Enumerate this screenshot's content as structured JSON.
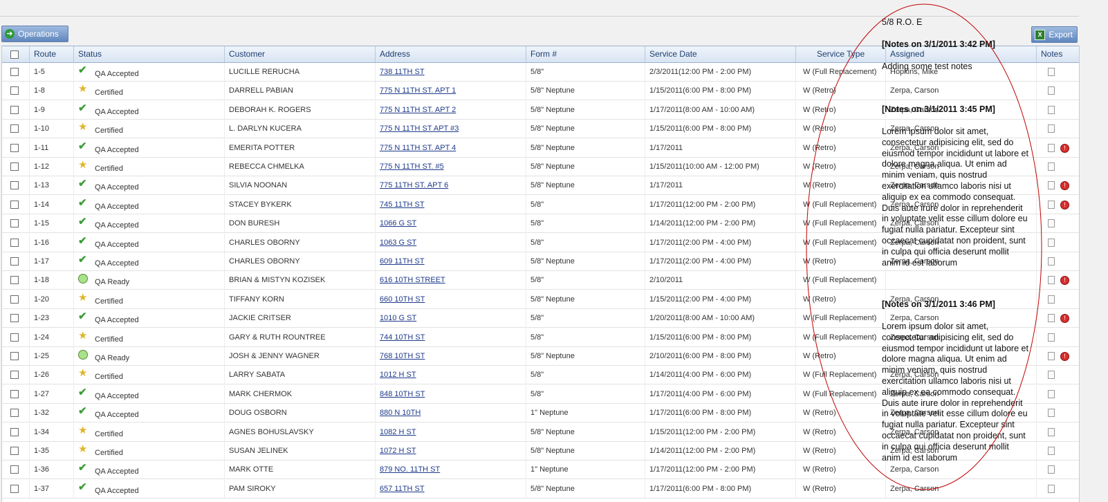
{
  "toolbar": {
    "operations_label": "Operations",
    "export_label": "Export",
    "export_icon": "excel-icon",
    "operations_icon": "arrow-right-icon"
  },
  "colors": {
    "header_text": "#1f3d6e",
    "link": "#1e3a8a",
    "annotation_ellipse": "#c00000",
    "note_flag": "#d92d2d",
    "check": "#3f9c3a",
    "star": "#e0b526"
  },
  "grid": {
    "columns": [
      "Route",
      "Status",
      "Customer",
      "Address",
      "Form #",
      "Service Date",
      "Service Type",
      "Assigned",
      "Notes"
    ],
    "rows": [
      {
        "route": "1-5",
        "status": "QA Accepted",
        "status_icon": "check",
        "customer": "LUCILLE RERUCHA",
        "address": "738 11TH ST",
        "form": "5/8\"",
        "date": "2/3/2011(12:00 PM - 2:00 PM)",
        "type": "W (Full Replacement)",
        "assigned": "Hopkins, Mike",
        "flag": false
      },
      {
        "route": "1-8",
        "status": "Certified",
        "status_icon": "star",
        "customer": "DARRELL PABIAN",
        "address": "775 N 11TH ST. APT 1",
        "form": "5/8\" Neptune",
        "date": "1/15/2011(6:00 PM - 8:00 PM)",
        "type": "W (Retro)",
        "assigned": "Zerpa, Carson",
        "flag": false
      },
      {
        "route": "1-9",
        "status": "QA Accepted",
        "status_icon": "check",
        "customer": "DEBORAH K. ROGERS",
        "address": "775 N 11TH ST. APT 2",
        "form": "5/8\" Neptune",
        "date": "1/17/2011(8:00 AM - 10:00 AM)",
        "type": "W (Retro)",
        "assigned": "Zerpa, Carson",
        "flag": false
      },
      {
        "route": "1-10",
        "status": "Certified",
        "status_icon": "star",
        "customer": "L. DARLYN KUCERA",
        "address": "775 N 11TH ST APT #3",
        "form": "5/8\" Neptune",
        "date": "1/15/2011(6:00 PM - 8:00 PM)",
        "type": "W (Retro)",
        "assigned": "Zerpa, Carson",
        "flag": false
      },
      {
        "route": "1-11",
        "status": "QA Accepted",
        "status_icon": "check",
        "customer": "EMERITA POTTER",
        "address": "775 N 11TH ST. APT 4",
        "form": "5/8\" Neptune",
        "date": "1/17/2011",
        "type": "W (Retro)",
        "assigned": "Zerpa, Carson",
        "flag": true
      },
      {
        "route": "1-12",
        "status": "Certified",
        "status_icon": "star",
        "customer": "REBECCA CHMELKA",
        "address": "775 N 11TH ST. #5",
        "form": "5/8\" Neptune",
        "date": "1/15/2011(10:00 AM - 12:00 PM)",
        "type": "W (Retro)",
        "assigned": "Zerpa, Carson",
        "flag": false
      },
      {
        "route": "1-13",
        "status": "QA Accepted",
        "status_icon": "check",
        "customer": "SILVIA NOONAN",
        "address": "775 11TH ST. APT 6",
        "form": "5/8\" Neptune",
        "date": "1/17/2011",
        "type": "W (Retro)",
        "assigned": "Zerpa, Carson",
        "flag": true
      },
      {
        "route": "1-14",
        "status": "QA Accepted",
        "status_icon": "check",
        "customer": "STACEY BYKERK",
        "address": "745 11TH ST",
        "form": "5/8\"",
        "date": "1/17/2011(12:00 PM - 2:00 PM)",
        "type": "W (Full Replacement)",
        "assigned": "Zerpa, Carson",
        "flag": true
      },
      {
        "route": "1-15",
        "status": "QA Accepted",
        "status_icon": "check",
        "customer": "DON BURESH",
        "address": "1066 G ST",
        "form": "5/8\"",
        "date": "1/14/2011(12:00 PM - 2:00 PM)",
        "type": "W (Full Replacement)",
        "assigned": "Zerpa, Carson",
        "flag": false
      },
      {
        "route": "1-16",
        "status": "QA Accepted",
        "status_icon": "check",
        "customer": "CHARLES OBORNY",
        "address": "1063 G ST",
        "form": "5/8\"",
        "date": "1/17/2011(2:00 PM - 4:00 PM)",
        "type": "W (Full Replacement)",
        "assigned": "Zerpa, Carson",
        "flag": false
      },
      {
        "route": "1-17",
        "status": "QA Accepted",
        "status_icon": "check",
        "customer": "CHARLES OBORNY",
        "address": "609 11TH ST",
        "form": "5/8\" Neptune",
        "date": "1/17/2011(2:00 PM - 4:00 PM)",
        "type": "W (Retro)",
        "assigned": "Zerpa, Carson",
        "flag": false
      },
      {
        "route": "1-18",
        "status": "QA Ready",
        "status_icon": "ready",
        "customer": "BRIAN & MISTYN KOZISEK",
        "address": "616 10TH STREET",
        "form": "5/8\"",
        "date": "2/10/2011",
        "type": "W (Full Replacement)",
        "assigned": "",
        "flag": true
      },
      {
        "route": "1-20",
        "status": "Certified",
        "status_icon": "star",
        "customer": "TIFFANY KORN",
        "address": "660 10TH ST",
        "form": "5/8\" Neptune",
        "date": "1/15/2011(2:00 PM - 4:00 PM)",
        "type": "W (Retro)",
        "assigned": "Zerpa, Carson",
        "flag": false
      },
      {
        "route": "1-23",
        "status": "QA Accepted",
        "status_icon": "check",
        "customer": "JACKIE CRITSER",
        "address": "1010 G ST",
        "form": "5/8\"",
        "date": "1/20/2011(8:00 AM - 10:00 AM)",
        "type": "W (Full Replacement)",
        "assigned": "Zerpa, Carson",
        "flag": true
      },
      {
        "route": "1-24",
        "status": "Certified",
        "status_icon": "star",
        "customer": "GARY & RUTH ROUNTREE",
        "address": "744 10TH ST",
        "form": "5/8\"",
        "date": "1/15/2011(6:00 PM - 8:00 PM)",
        "type": "W (Full Replacement)",
        "assigned": "Zerpa, Carson",
        "flag": false
      },
      {
        "route": "1-25",
        "status": "QA Ready",
        "status_icon": "ready",
        "customer": "JOSH & JENNY WAGNER",
        "address": "768 10TH ST",
        "form": "5/8\" Neptune",
        "date": "2/10/2011(6:00 PM - 8:00 PM)",
        "type": "W (Retro)",
        "assigned": "",
        "flag": true
      },
      {
        "route": "1-26",
        "status": "Certified",
        "status_icon": "star",
        "customer": "LARRY SABATA",
        "address": "1012 H ST",
        "form": "5/8\"",
        "date": "1/14/2011(4:00 PM - 6:00 PM)",
        "type": "W (Full Replacement)",
        "assigned": "Zerpa, Carson",
        "flag": false
      },
      {
        "route": "1-27",
        "status": "QA Accepted",
        "status_icon": "check",
        "customer": "MARK CHERMOK",
        "address": "848 10TH ST",
        "form": "5/8\"",
        "date": "1/17/2011(4:00 PM - 6:00 PM)",
        "type": "W (Full Replacement)",
        "assigned": "Zerpa, Carson",
        "flag": false
      },
      {
        "route": "1-32",
        "status": "QA Accepted",
        "status_icon": "check",
        "customer": "DOUG OSBORN",
        "address": "880 N 10TH",
        "form": "1\" Neptune",
        "date": "1/17/2011(6:00 PM - 8:00 PM)",
        "type": "W (Retro)",
        "assigned": "Zerpa, Carson",
        "flag": false
      },
      {
        "route": "1-34",
        "status": "Certified",
        "status_icon": "star",
        "customer": "AGNES BOHUSLAVSKY",
        "address": "1082 H ST",
        "form": "5/8\" Neptune",
        "date": "1/15/2011(12:00 PM - 2:00 PM)",
        "type": "W (Retro)",
        "assigned": "Zerpa, Carson",
        "flag": false
      },
      {
        "route": "1-35",
        "status": "Certified",
        "status_icon": "star",
        "customer": "SUSAN JELINEK",
        "address": "1072 H ST",
        "form": "5/8\" Neptune",
        "date": "1/14/2011(12:00 PM - 2:00 PM)",
        "type": "W (Retro)",
        "assigned": "Zerpa, Carson",
        "flag": false
      },
      {
        "route": "1-36",
        "status": "QA Accepted",
        "status_icon": "check",
        "customer": "MARK OTTE",
        "address": "879 NO. 11TH ST",
        "form": "1\" Neptune",
        "date": "1/17/2011(12:00 PM - 2:00 PM)",
        "type": "W (Retro)",
        "assigned": "Zerpa, Carson",
        "flag": false
      },
      {
        "route": "1-37",
        "status": "QA Accepted",
        "status_icon": "check",
        "customer": "PAM SIROKY",
        "address": "657 11TH ST",
        "form": "5/8\" Neptune",
        "date": "1/17/2011(6:00 PM - 8:00 PM)",
        "type": "W (Retro)",
        "assigned": "Zerpa, Carson",
        "flag": false
      }
    ]
  },
  "notes_popup": {
    "title": "5/8 R.O. E",
    "entries": [
      {
        "header": "[Notes on 3/1/2011 3:42 PM]",
        "text": "Adding some test notes"
      },
      {
        "header": "[Notes on 3/1/2011 3:45 PM]",
        "text": "Lorem ipsum dolor sit amet, consectetur adipisicing elit, sed do eiusmod tempor incididunt ut labore et dolore magna aliqua. Ut enim ad minim veniam, quis nostrud exercitation ullamco laboris nisi ut aliquip ex ea commodo consequat. Duis aute irure dolor in reprehenderit in voluptate velit esse cillum dolore eu fugiat nulla pariatur. Excepteur sint occaecat cupidatat non proident, sunt in culpa qui officia deserunt mollit anim id est laborum"
      },
      {
        "header": "[Notes on 3/1/2011 3:46 PM]",
        "text": "Lorem ipsum dolor sit amet, consectetur adipisicing elit, sed do eiusmod tempor incididunt ut labore et dolore magna aliqua. Ut enim ad minim veniam, quis nostrud exercitation ullamco laboris nisi ut aliquip ex ea commodo consequat. Duis aute irure dolor in reprehenderit in voluptate velit esse cillum dolore eu fugiat nulla pariatur. Excepteur sint occaecat cupidatat non proident, sunt in culpa qui officia deserunt mollit anim id est laborum"
      }
    ]
  }
}
